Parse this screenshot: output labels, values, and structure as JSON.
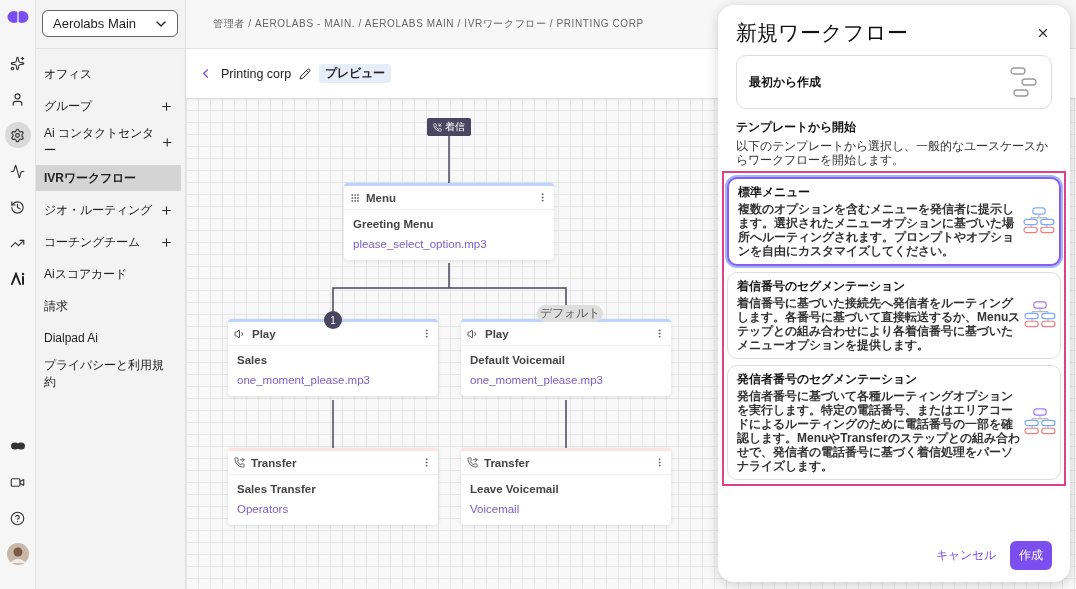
{
  "account_select": {
    "value": "Aerolabs Main"
  },
  "rail": {
    "items": [
      {
        "kind": "sparkle",
        "selected": false
      },
      {
        "kind": "person",
        "selected": false
      },
      {
        "kind": "gear",
        "selected": true
      },
      {
        "kind": "activity",
        "selected": false
      },
      {
        "kind": "history",
        "selected": false
      },
      {
        "kind": "trend",
        "selected": false
      },
      {
        "kind": "ai",
        "selected": false
      }
    ],
    "bottom": [
      {
        "kind": "logo"
      },
      {
        "kind": "video"
      },
      {
        "kind": "help"
      },
      {
        "kind": "avatar"
      }
    ]
  },
  "sidebar": {
    "items": [
      {
        "label": "オフィス",
        "expandable": false,
        "selected": false
      },
      {
        "label": "グループ",
        "expandable": true,
        "selected": false
      },
      {
        "label": "Ai コンタクトセンター",
        "expandable": true,
        "selected": false
      },
      {
        "label": "IVRワークフロー",
        "expandable": false,
        "selected": true
      },
      {
        "label": "ジオ・ルーティング",
        "expandable": true,
        "selected": false
      },
      {
        "label": "コーチングチーム",
        "expandable": true,
        "selected": false
      },
      {
        "label": "Aiスコアカード",
        "expandable": false,
        "selected": false
      },
      {
        "label": "請求",
        "expandable": false,
        "selected": false
      },
      {
        "label": "Dialpad Ai",
        "expandable": false,
        "selected": false
      },
      {
        "label": "プライバシーと利用規約",
        "expandable": false,
        "selected": false
      }
    ]
  },
  "breadcrumb": "管理者 / AEROLABS - MAIN. / AEROLABS MAIN / IVRワークフロー / PRINTING CORP",
  "header": {
    "title": "Printing corp",
    "badge": "プレビュー"
  },
  "flow": {
    "start": "着信",
    "nodes": [
      {
        "kind": "menu",
        "type_label": "Menu",
        "title": "Greeting Menu",
        "link": "please_select_option.mp3"
      },
      {
        "kind": "play",
        "type_label": "Play",
        "title": "Sales",
        "link": "one_moment_please.mp3",
        "branch": {
          "kind": "number",
          "label": "1"
        }
      },
      {
        "kind": "play",
        "type_label": "Play",
        "title": "Default Voicemail",
        "link": "one_moment_please.mp3",
        "branch": {
          "kind": "pill",
          "label": "デフォルト"
        }
      },
      {
        "kind": "transfer",
        "type_label": "Transfer",
        "title": "Sales Transfer",
        "link": "Operators"
      },
      {
        "kind": "transfer",
        "type_label": "Transfer",
        "title": "Leave Voicemail",
        "link": "Voicemail"
      }
    ]
  },
  "dialog": {
    "title": "新規ワークフロー",
    "scratch": {
      "label": "最初から作成"
    },
    "section_title": "テンプレートから開始",
    "section_text": "以下のテンプレートから選択し、一般的なユースケースからワークフローを開始します。",
    "templates": [
      {
        "title": "標準メニュー",
        "text": "複数のオプションを含むメニューを発信者に提示します。選択されたメニューオプションに基づいた場所へルーティングされます。プロンプトやオプションを自由にカスタマイズしてください。",
        "selected": true
      },
      {
        "title": "着信番号のセグメンテーション",
        "text": "着信番号に基づいた接続先へ発信者をルーティングします。各番号に基づいて直接転送するか、Menuステップとの組み合わせにより各着信番号に基づいたメニューオプションを提供します。",
        "selected": false
      },
      {
        "title": "発信者番号のセグメンテーション",
        "text": "発信者番号に基づいて各種ルーティングオプションを実行します。特定の電話番号、またはエリアコードによるルーティングのために電話番号の一部を確認します。MenuやTransferのステップとの組み合わせで、発信者の電話番号に基づく着信処理をパーソナライズします。",
        "selected": false
      }
    ],
    "cancel": "キャンセル",
    "create": "作成"
  }
}
